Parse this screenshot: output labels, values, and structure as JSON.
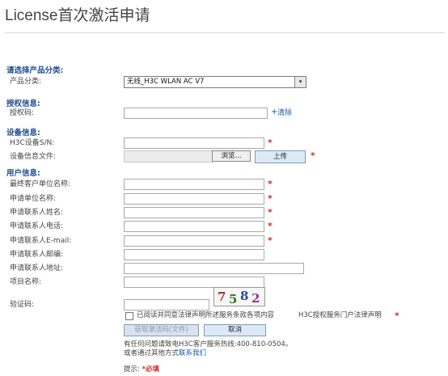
{
  "page": {
    "title": "License首次激活申请"
  },
  "sections": {
    "product": "请选择产品分类:",
    "license": "授权信息:",
    "device": "设备信息:",
    "user": "用户信息:"
  },
  "product": {
    "label": "产品分类:",
    "selected": "无线_H3C WLAN AC V7",
    "arrow": "▾"
  },
  "license": {
    "code_label": "授权码:",
    "clear_link": "清除",
    "plus": "+"
  },
  "device": {
    "sn_label": "H3C设备S/N:",
    "file_label": "设备信息文件:",
    "browse_button": "浏览...",
    "upload_button": "上传"
  },
  "user": {
    "end_customer_label": "最终客户单位名称:",
    "applicant_org_label": "申请单位名称:",
    "contact_name_label": "申请联系人姓名:",
    "contact_phone_label": "申请联系人电话:",
    "contact_email_label": "申请联系人E-mail:",
    "contact_postcode_label": "申请联系人邮编:",
    "contact_address_label": "申请联系人地址:",
    "project_label": "项目名称:"
  },
  "captcha": {
    "label": "验证码:",
    "digits": [
      "7",
      "5",
      "8",
      "2"
    ]
  },
  "agreement": {
    "text": "已阅读并同意法律声明所述服务条款各项内容",
    "link": "H3C授权服务门户法律声明"
  },
  "actions": {
    "submit": "获取激活码(文件)",
    "cancel": "取消"
  },
  "help": {
    "line1": "有任何问题请致电H3C客户服务热线:400-810-0504。",
    "line2_prefix": "或者通过其他方式",
    "line2_link": "联系我们"
  },
  "hint": {
    "label": "提示:",
    "required": "*必填"
  },
  "required_mark": "*",
  "colors": {
    "section": "#1f4f8f",
    "required": "#d62a2a",
    "link": "#1a5aa8",
    "button_bg": "#dde9f5"
  }
}
